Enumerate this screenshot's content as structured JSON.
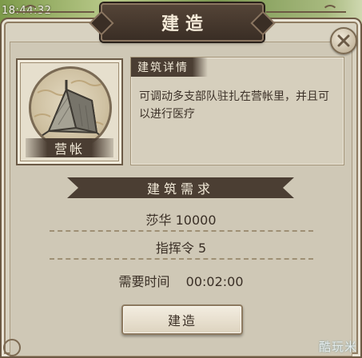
{
  "status": {
    "clock": "18:44:32"
  },
  "dialog": {
    "title": "建造",
    "close_icon": "close-x-icon"
  },
  "building": {
    "name": "营帐",
    "icon": "tent-icon",
    "detail_heading": "建筑详情",
    "description": "可调动多支部队驻扎在营帐里，并且可以进行医疗"
  },
  "requirements": {
    "heading": "建筑需求",
    "items": [
      {
        "label": "莎华",
        "value": "10000"
      },
      {
        "label": "指挥令",
        "value": "5"
      },
      {
        "label": "需要时间",
        "value": "00:02:00"
      }
    ]
  },
  "actions": {
    "build_label": "建造"
  },
  "watermark": "酷玩米",
  "colors": {
    "panel": "#d8d2c1",
    "frame_dark": "#4b3e33",
    "text": "#3a2f26"
  }
}
